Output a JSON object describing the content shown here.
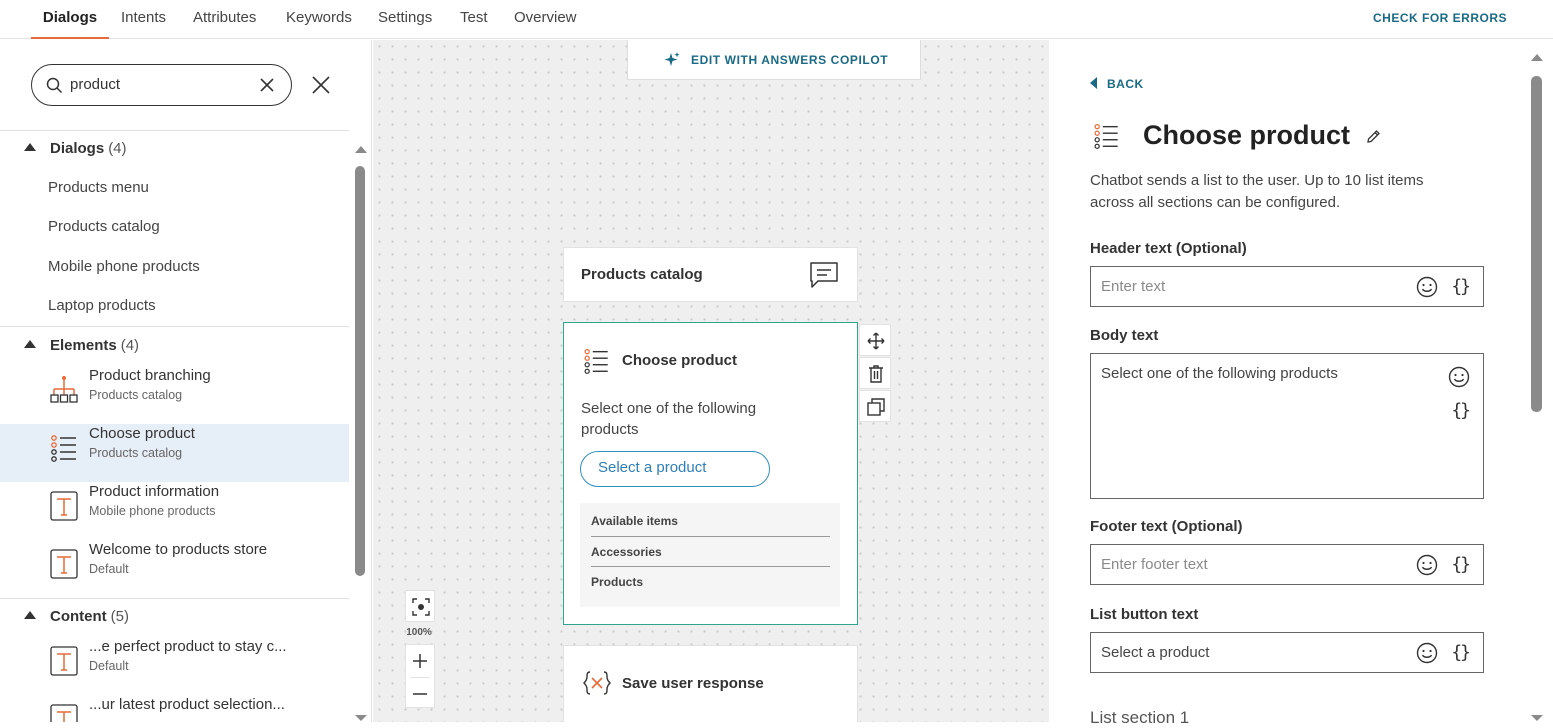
{
  "nav": {
    "tabs": [
      {
        "label": "Dialogs",
        "active": true
      },
      {
        "label": "Intents"
      },
      {
        "label": "Attributes"
      },
      {
        "label": "Keywords"
      },
      {
        "label": "Settings"
      },
      {
        "label": "Test"
      },
      {
        "label": "Overview"
      }
    ],
    "check_errors": "CHECK FOR ERRORS"
  },
  "search": {
    "value": "product"
  },
  "sections": {
    "dialogs": {
      "title": "Dialogs",
      "count": "(4)",
      "items": [
        "Products menu",
        "Products catalog",
        "Mobile phone products",
        "Laptop products"
      ]
    },
    "elements": {
      "title": "Elements",
      "count": "(4)",
      "items": [
        {
          "title": "Product branching",
          "sub": "Products catalog",
          "icon": "branching-icon"
        },
        {
          "title": "Choose product",
          "sub": "Products catalog",
          "icon": "list-icon",
          "selected": true
        },
        {
          "title": "Product information",
          "sub": "Mobile phone products",
          "icon": "text-icon"
        },
        {
          "title": "Welcome to products store",
          "sub": "Default",
          "icon": "text-icon"
        }
      ]
    },
    "content": {
      "title": "Content",
      "count": "(5)",
      "items": [
        {
          "title": "...e perfect product to stay c...",
          "sub": "Default",
          "icon": "text-icon"
        },
        {
          "title": "...ur latest product selection...",
          "sub": "",
          "icon": "text-icon"
        }
      ]
    }
  },
  "canvas": {
    "copilot": "EDIT WITH ANSWERS COPILOT",
    "node_catalog": "Products catalog",
    "node_choose": {
      "title": "Choose product",
      "body": "Select one of the following products",
      "button": "Select a product",
      "items": [
        "Available items",
        "Accessories",
        "Products"
      ]
    },
    "node_save": "Save user response",
    "zoom": "100%"
  },
  "panel": {
    "back": "BACK",
    "title": "Choose product",
    "description": "Chatbot sends a list to the user. Up to 10 list items across all sections can be configured.",
    "header_label": "Header text (Optional)",
    "header_placeholder": "Enter text",
    "body_label": "Body text",
    "body_value": "Select one of the following products",
    "footer_label": "Footer text (Optional)",
    "footer_placeholder": "Enter footer text",
    "list_button_label": "List button text",
    "list_button_value": "Select a product",
    "list_section": "List section 1",
    "brace": "{}"
  },
  "colors": {
    "accent": "#e86a3a",
    "link": "#1a6a86",
    "selected_border": "#2fa58d",
    "selected_bg": "#e6eef7"
  }
}
